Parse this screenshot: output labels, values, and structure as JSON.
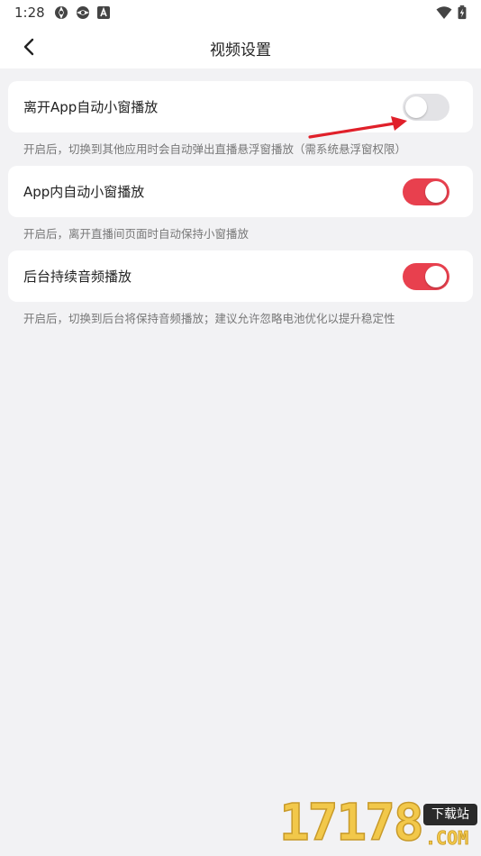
{
  "status_bar": {
    "time": "1:28",
    "left_icons": [
      "aperture-icon",
      "aperture-icon",
      "a-badge-icon"
    ],
    "right_icons": [
      "wifi-icon",
      "battery-charging-icon"
    ]
  },
  "header": {
    "title": "视频设置",
    "back_icon": "chevron-left-icon"
  },
  "settings": [
    {
      "label": "离开App自动小窗播放",
      "enabled": false,
      "description": "开启后，切换到其他应用时会自动弹出直播悬浮窗播放（需系统悬浮窗权限）"
    },
    {
      "label": "App内自动小窗播放",
      "enabled": true,
      "description": "开启后，离开直播间页面时自动保持小窗播放"
    },
    {
      "label": "后台持续音频播放",
      "enabled": true,
      "description": "开启后，切换到后台将保持音频播放；建议允许忽略电池优化以提升稳定性"
    }
  ],
  "annotation": {
    "arrow_color": "#e0202a"
  },
  "watermark": {
    "digits": "17178",
    "tag": "下载站",
    "domain": ".COM"
  },
  "colors": {
    "toggle_on": "#e8404e",
    "toggle_off": "#e3e3e6",
    "background": "#f2f2f4"
  }
}
